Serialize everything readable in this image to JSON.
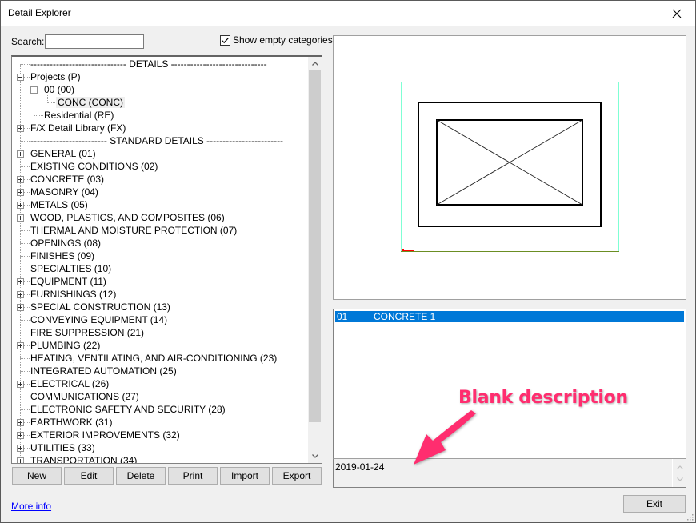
{
  "window": {
    "title": "Detail Explorer",
    "close_icon": "close-icon"
  },
  "search": {
    "label": "Search:",
    "value": "",
    "placeholder": ""
  },
  "show_empty": {
    "label": "Show empty categories",
    "checked": true
  },
  "tree": {
    "items": [
      {
        "label": "------------------------------ DETAILS ------------------------------",
        "level": 0,
        "expander": "none"
      },
      {
        "label": "Projects (P)",
        "level": 0,
        "expander": "minus"
      },
      {
        "label": "00 (00)",
        "level": 1,
        "expander": "minus"
      },
      {
        "label": "CONC (CONC)",
        "level": 2,
        "expander": "none",
        "selected": true
      },
      {
        "label": "Residential (RE)",
        "level": 1,
        "expander": "none"
      },
      {
        "label": "F/X Detail Library (FX)",
        "level": 0,
        "expander": "plus"
      },
      {
        "label": "------------------------ STANDARD DETAILS ------------------------",
        "level": 0,
        "expander": "none"
      },
      {
        "label": "GENERAL (01)",
        "level": 0,
        "expander": "plus"
      },
      {
        "label": "EXISTING CONDITIONS (02)",
        "level": 0,
        "expander": "none"
      },
      {
        "label": "CONCRETE (03)",
        "level": 0,
        "expander": "plus"
      },
      {
        "label": "MASONRY (04)",
        "level": 0,
        "expander": "plus"
      },
      {
        "label": "METALS (05)",
        "level": 0,
        "expander": "plus"
      },
      {
        "label": "WOOD, PLASTICS, AND COMPOSITES (06)",
        "level": 0,
        "expander": "plus"
      },
      {
        "label": "THERMAL AND MOISTURE PROTECTION (07)",
        "level": 0,
        "expander": "none"
      },
      {
        "label": "OPENINGS (08)",
        "level": 0,
        "expander": "none"
      },
      {
        "label": "FINISHES (09)",
        "level": 0,
        "expander": "none"
      },
      {
        "label": "SPECIALTIES (10)",
        "level": 0,
        "expander": "none"
      },
      {
        "label": "EQUIPMENT (11)",
        "level": 0,
        "expander": "plus"
      },
      {
        "label": "FURNISHINGS (12)",
        "level": 0,
        "expander": "plus"
      },
      {
        "label": "SPECIAL CONSTRUCTION (13)",
        "level": 0,
        "expander": "plus"
      },
      {
        "label": "CONVEYING EQUIPMENT (14)",
        "level": 0,
        "expander": "none"
      },
      {
        "label": "FIRE SUPPRESSION (21)",
        "level": 0,
        "expander": "none"
      },
      {
        "label": "PLUMBING (22)",
        "level": 0,
        "expander": "plus"
      },
      {
        "label": "HEATING, VENTILATING, AND AIR-CONDITIONING (23)",
        "level": 0,
        "expander": "none"
      },
      {
        "label": "INTEGRATED AUTOMATION (25)",
        "level": 0,
        "expander": "none"
      },
      {
        "label": "ELECTRICAL (26)",
        "level": 0,
        "expander": "plus"
      },
      {
        "label": "COMMUNICATIONS (27)",
        "level": 0,
        "expander": "none"
      },
      {
        "label": "ELECTRONIC SAFETY AND SECURITY (28)",
        "level": 0,
        "expander": "none"
      },
      {
        "label": "EARTHWORK (31)",
        "level": 0,
        "expander": "plus"
      },
      {
        "label": "EXTERIOR IMPROVEMENTS (32)",
        "level": 0,
        "expander": "plus"
      },
      {
        "label": "UTILITIES (33)",
        "level": 0,
        "expander": "plus"
      },
      {
        "label": "TRANSPORTATION (34)",
        "level": 0,
        "expander": "plus"
      }
    ]
  },
  "buttons": {
    "new": "New",
    "edit": "Edit",
    "delete": "Delete",
    "print": "Print",
    "import": "Import",
    "export": "Export",
    "exit": "Exit"
  },
  "more_info": "More info",
  "detail_list": {
    "rows": [
      {
        "number": "01",
        "name": "CONCRETE 1",
        "selected": true
      }
    ]
  },
  "description": {
    "text": "2019-01-24"
  },
  "annotation": {
    "text": "Blank description",
    "color": "#ff2d6f"
  },
  "colors": {
    "selection": "#0078d7",
    "link": "#0000ff",
    "preview_border": "#7fffd4"
  }
}
